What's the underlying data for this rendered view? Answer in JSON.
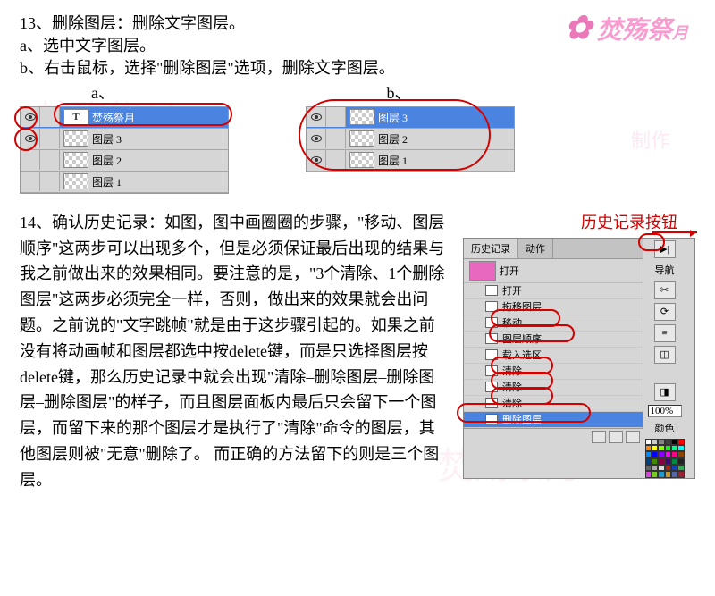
{
  "step13": {
    "title": "13、删除图层：删除文字图层。",
    "sub_a": "a、选中文字图层。",
    "sub_b": "b、右击鼠标，选择\"删除图层\"选项，删除文字图层。",
    "label_a": "a、",
    "label_b": "b、"
  },
  "panel_a": {
    "layers": [
      {
        "name": "焚殇祭月",
        "type": "text",
        "selected": true
      },
      {
        "name": "图层 3",
        "type": "bitmap",
        "selected": false
      },
      {
        "name": "图层 2",
        "type": "bitmap",
        "selected": false
      },
      {
        "name": "图层 1",
        "type": "bitmap",
        "selected": false
      }
    ]
  },
  "panel_b": {
    "layers": [
      {
        "name": "图层 3",
        "type": "bitmap",
        "selected": true
      },
      {
        "name": "图层 2",
        "type": "bitmap",
        "selected": false
      },
      {
        "name": "图层 1",
        "type": "bitmap",
        "selected": false
      }
    ]
  },
  "step14": {
    "text": "14、确认历史记录：如图，图中画圈圈的步骤，\"移动、图层顺序\"这两步可以出现多个，但是必须保证最后出现的结果与我之前做出来的效果相同。要注意的是，\"3个清除、1个删除图层\"这两步必须完全一样，否则，做出来的效果就会出问题。之前说的\"文字跳帧\"就是由于这步骤引起的。如果之前没有将动画帧和图层都选中按delete键，而是只选择图层按delete键，那么历史记录中就会出现\"清除–删除图层–删除图层–删除图层\"的样子，而且图层面板内最后只会留下一个图层，而留下来的那个图层才是执行了\"清除\"命令的图层，其他图层则被\"无意\"删除了。 而正确的方法留下的则是三个图层。"
  },
  "history": {
    "label": "历史记录按钮",
    "tabs": {
      "history": "历史记录",
      "actions": "动作"
    },
    "nav_label": "导航",
    "doc_name": "打开",
    "items": [
      {
        "name": "打开"
      },
      {
        "name": "拖移图层"
      },
      {
        "name": "移动"
      },
      {
        "name": "图层顺序"
      },
      {
        "name": "载入选区"
      },
      {
        "name": "清除"
      },
      {
        "name": "清除"
      },
      {
        "name": "清除"
      },
      {
        "name": "删除图层",
        "selected": true
      }
    ],
    "zoom": "100%",
    "color_label": "颜色"
  },
  "swatch_colors": [
    "#fff",
    "#ccc",
    "#888",
    "#444",
    "#000",
    "#f00",
    "#f80",
    "#ff0",
    "#8f0",
    "#0f0",
    "#0f8",
    "#0ff",
    "#08f",
    "#00f",
    "#80f",
    "#f0f",
    "#f08",
    "#840",
    "#048",
    "#480",
    "#804",
    "#408",
    "#084",
    "#222",
    "#666",
    "#aaa",
    "#ddd",
    "#b21",
    "#14b",
    "#3a5",
    "#d4d",
    "#7c2",
    "#29c",
    "#c92",
    "#56a",
    "#923"
  ]
}
